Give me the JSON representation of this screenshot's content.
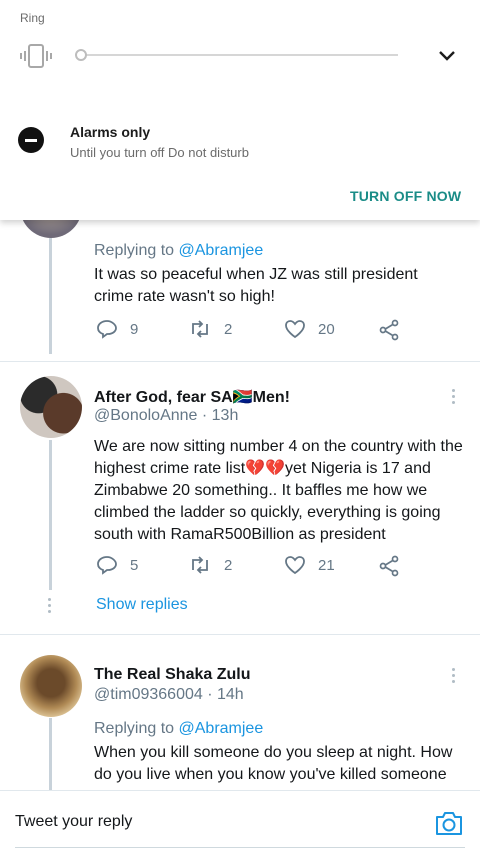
{
  "shade": {
    "ring_label": "Ring",
    "dnd_title": "Alarms only",
    "dnd_subtitle": "Until you turn off Do not disturb",
    "turn_off_label": "TURN OFF NOW"
  },
  "tweets": [
    {
      "reply_prefix": "Replying to ",
      "reply_mention": "@Abramjee",
      "text_line1": "It was so peaceful when JZ was still president",
      "text_line2": "crime rate wasn't so high!",
      "replies": "9",
      "retweets": "2",
      "likes": "20"
    },
    {
      "name": "After God, fear SA🇿🇦Men!",
      "handle": "@BonoloAnne · 13h",
      "text_line1": "We are now sitting number 4 on the country with the",
      "text_line2": "highest crime rate list💔💔yet Nigeria is 17 and",
      "text_line3": "Zimbabwe 20 something.. It baffles me how we",
      "text_line4": "climbed the ladder so quickly, everything is going",
      "text_line5": "south with RamaR500Billion as president",
      "replies": "5",
      "retweets": "2",
      "likes": "21",
      "show_replies": "Show replies"
    },
    {
      "name": "The Real Shaka Zulu",
      "handle": "@tim09366004 · 14h",
      "reply_prefix": "Replying to ",
      "reply_mention": "@Abramjee",
      "text_line1": "When you kill someone do you sleep at night. How",
      "text_line2": "do you live when you know you've killed someone"
    }
  ],
  "reply_bar": {
    "placeholder": "Tweet your reply"
  },
  "colors": {
    "accent": "#1b95e0",
    "teal": "#1a8c87",
    "muted": "#657786"
  }
}
